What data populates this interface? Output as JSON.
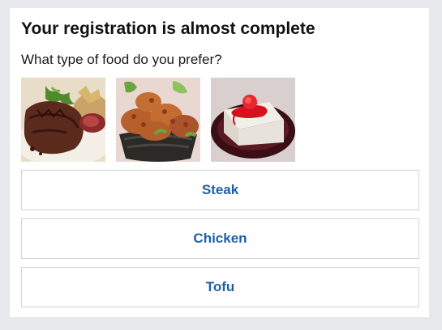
{
  "card": {
    "title": "Your registration is almost complete",
    "question": "What type of food do you prefer?"
  },
  "food_images": [
    {
      "icon": "steak-image"
    },
    {
      "icon": "fried-chicken-image"
    },
    {
      "icon": "tofu-image"
    }
  ],
  "options": [
    {
      "label": "Steak"
    },
    {
      "label": "Chicken"
    },
    {
      "label": "Tofu"
    }
  ],
  "colors": {
    "page_background": "#e6e8ec",
    "card_background": "#ffffff",
    "option_text": "#1f5fa8",
    "option_border": "#d3d3d3"
  }
}
